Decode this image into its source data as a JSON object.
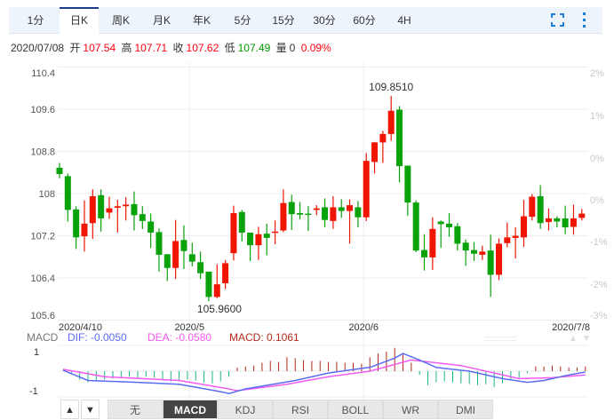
{
  "period_tabs": [
    {
      "label": "1分"
    },
    {
      "label": "日K",
      "active": true
    },
    {
      "label": "周K"
    },
    {
      "label": "月K"
    },
    {
      "label": "年K"
    },
    {
      "label": "5分"
    },
    {
      "label": "15分"
    },
    {
      "label": "30分"
    },
    {
      "label": "60分"
    },
    {
      "label": "4H"
    }
  ],
  "info": {
    "date": "2020/07/08",
    "open_label": "开",
    "open": "107.54",
    "high_label": "高",
    "high": "107.71",
    "close_label": "收",
    "close": "107.62",
    "low_label": "低",
    "low": "107.49",
    "vol_label": "量",
    "vol": "0",
    "change": "0.09%"
  },
  "indicator_tabs": [
    "无",
    "MACD",
    "KDJ",
    "RSI",
    "BOLL",
    "WR",
    "DMI"
  ],
  "active_indicator": "MACD",
  "colors": {
    "up": "#f01500",
    "down": "#0aa20a",
    "dif": "#5b6cf2",
    "dea": "#f35af0",
    "macd": "#b22a1a",
    "accent": "#1a7fd6"
  },
  "chart_data": {
    "type": "candlestick",
    "y_ticks": [
      "110.4",
      "109.6",
      "108.8",
      "108",
      "107.2",
      "106.4",
      "105.6"
    ],
    "y_tick_values": [
      110.4,
      109.6,
      108.8,
      108,
      107.2,
      106.4,
      105.6
    ],
    "pct_ticks": [
      "2%",
      "1%",
      "0%",
      "0%",
      "-1%",
      "-2%",
      "-3%"
    ],
    "x_labels": [
      "2020/4/10",
      "2020/5",
      "2020/6",
      "2020/7/8"
    ],
    "x_label_index": [
      0,
      16,
      37,
      63
    ],
    "max_label": "109.8510",
    "max_index": 40,
    "min_label": "105.9600",
    "min_index": 18,
    "candles": [
      [
        108.49,
        108.58,
        108.29,
        108.37
      ],
      [
        108.33,
        108.38,
        107.47,
        107.69
      ],
      [
        107.7,
        107.76,
        106.95,
        107.17
      ],
      [
        107.19,
        107.87,
        106.9,
        107.43
      ],
      [
        107.44,
        108.08,
        107.14,
        107.95
      ],
      [
        107.97,
        108.08,
        107.28,
        107.53
      ],
      [
        107.64,
        107.94,
        107.52,
        107.72
      ],
      [
        107.73,
        107.88,
        107.26,
        107.76
      ],
      [
        107.76,
        107.93,
        107.49,
        107.79
      ],
      [
        107.8,
        108.04,
        107.3,
        107.59
      ],
      [
        107.61,
        107.76,
        107.33,
        107.48
      ],
      [
        107.47,
        107.62,
        106.97,
        107.26
      ],
      [
        107.27,
        107.34,
        106.52,
        106.84
      ],
      [
        106.85,
        106.85,
        106.34,
        106.59
      ],
      [
        106.59,
        107.5,
        106.38,
        107.1
      ],
      [
        107.12,
        107.4,
        106.57,
        106.91
      ],
      [
        106.85,
        107.07,
        106.62,
        106.71
      ],
      [
        106.7,
        106.9,
        106.38,
        106.49
      ],
      [
        106.52,
        106.52,
        105.96,
        106.04
      ],
      [
        106.04,
        106.66,
        106.02,
        106.28
      ],
      [
        106.3,
        106.74,
        106.19,
        106.68
      ],
      [
        106.87,
        107.77,
        106.73,
        107.63
      ],
      [
        107.65,
        107.69,
        107.09,
        107.26
      ],
      [
        107.26,
        107.26,
        106.72,
        107.02
      ],
      [
        107.02,
        107.37,
        106.74,
        107.23
      ],
      [
        107.24,
        107.43,
        106.83,
        107.16
      ],
      [
        107.26,
        107.49,
        107.04,
        107.28
      ],
      [
        107.3,
        108.08,
        107.27,
        107.82
      ],
      [
        107.84,
        107.98,
        107.31,
        107.61
      ],
      [
        107.63,
        107.84,
        107.51,
        107.6
      ],
      [
        107.62,
        107.76,
        107.29,
        107.61
      ],
      [
        107.69,
        107.78,
        107.59,
        107.72
      ],
      [
        107.74,
        107.91,
        107.36,
        107.5
      ],
      [
        107.48,
        107.95,
        107.33,
        107.74
      ],
      [
        107.74,
        107.89,
        107.54,
        107.67
      ],
      [
        107.67,
        107.89,
        107.05,
        107.78
      ],
      [
        107.74,
        107.86,
        107.36,
        107.55
      ],
      [
        107.55,
        108.77,
        107.48,
        108.62
      ],
      [
        108.6,
        108.98,
        108.38,
        108.97
      ],
      [
        108.97,
        109.19,
        108.58,
        109.13
      ],
      [
        109.13,
        109.85,
        109.0,
        109.57
      ],
      [
        109.59,
        109.66,
        108.21,
        108.52
      ],
      [
        108.53,
        108.53,
        107.58,
        107.83
      ],
      [
        107.83,
        107.87,
        106.89,
        106.92
      ],
      [
        106.93,
        107.23,
        106.54,
        106.79
      ],
      [
        106.79,
        107.55,
        106.55,
        107.33
      ],
      [
        107.47,
        107.49,
        106.97,
        107.42
      ],
      [
        107.43,
        107.63,
        107.18,
        107.36
      ],
      [
        107.38,
        107.44,
        106.92,
        107.05
      ],
      [
        107.07,
        107.13,
        106.63,
        106.92
      ],
      [
        106.93,
        107.08,
        106.72,
        106.86
      ],
      [
        106.84,
        107.01,
        106.74,
        106.9
      ],
      [
        106.92,
        107.22,
        106.04,
        106.46
      ],
      [
        106.46,
        107.15,
        106.36,
        107.05
      ],
      [
        107.06,
        107.45,
        106.98,
        107.17
      ],
      [
        107.16,
        107.36,
        106.77,
        107.2
      ],
      [
        107.17,
        107.88,
        106.99,
        107.57
      ],
      [
        107.56,
        107.99,
        107.49,
        107.94
      ],
      [
        107.95,
        108.16,
        107.33,
        107.44
      ],
      [
        107.46,
        107.72,
        107.3,
        107.53
      ],
      [
        107.53,
        107.57,
        107.36,
        107.47
      ],
      [
        107.53,
        107.77,
        107.23,
        107.36
      ],
      [
        107.37,
        107.79,
        107.22,
        107.53
      ],
      [
        107.54,
        107.71,
        107.49,
        107.62
      ]
    ],
    "macd": {
      "label": "MACD",
      "dif_label": "DIF: -0.0050",
      "dea_label": "DEA: -0.0580",
      "macd_label": "MACD: 0.1061",
      "y_ticks": [
        "1",
        "-1"
      ],
      "hist": [
        0.02,
        -0.1,
        -0.45,
        -0.6,
        -0.55,
        -0.45,
        -0.4,
        -0.35,
        -0.3,
        -0.4,
        -0.3,
        -0.35,
        -0.45,
        -0.55,
        -0.5,
        -0.45,
        -0.5,
        -0.6,
        -0.65,
        -0.55,
        -0.3,
        0.2,
        0.25,
        0.3,
        0.45,
        0.55,
        0.5,
        0.75,
        0.7,
        0.6,
        0.55,
        0.55,
        0.5,
        0.5,
        0.45,
        0.45,
        0.4,
        0.75,
        0.95,
        1.05,
        1.25,
        0.9,
        0.45,
        -0.2,
        -0.75,
        -0.6,
        -0.55,
        -0.6,
        -0.65,
        -0.7,
        -0.75,
        -0.7,
        -0.85,
        -0.65,
        -0.45,
        -0.35,
        -0.1,
        0.25,
        0.25,
        0.3,
        0.25,
        0.2,
        0.2,
        0.25
      ],
      "dif_points": [
        [
          0,
          0.05
        ],
        [
          3,
          -0.5
        ],
        [
          9,
          -0.6
        ],
        [
          14,
          -0.7
        ],
        [
          19,
          -1.1
        ],
        [
          20,
          -1.2
        ],
        [
          22,
          -0.95
        ],
        [
          28,
          -0.5
        ],
        [
          32,
          -0.1
        ],
        [
          36,
          0.15
        ],
        [
          37,
          0.2
        ],
        [
          40,
          0.7
        ],
        [
          41,
          0.95
        ],
        [
          43,
          0.6
        ],
        [
          45,
          0.2
        ],
        [
          49,
          0
        ],
        [
          53,
          -0.4
        ],
        [
          56,
          -0.6
        ],
        [
          58,
          -0.5
        ],
        [
          61,
          -0.2
        ],
        [
          63,
          -0.05
        ]
      ],
      "dea_points": [
        [
          0,
          0.1
        ],
        [
          5,
          -0.3
        ],
        [
          14,
          -0.5
        ],
        [
          20,
          -0.95
        ],
        [
          21,
          -1.05
        ],
        [
          27,
          -0.7
        ],
        [
          32,
          -0.3
        ],
        [
          37,
          0
        ],
        [
          42,
          0.6
        ],
        [
          48,
          0.3
        ],
        [
          55,
          -0.4
        ],
        [
          59,
          -0.35
        ],
        [
          63,
          -0.2
        ]
      ]
    }
  }
}
